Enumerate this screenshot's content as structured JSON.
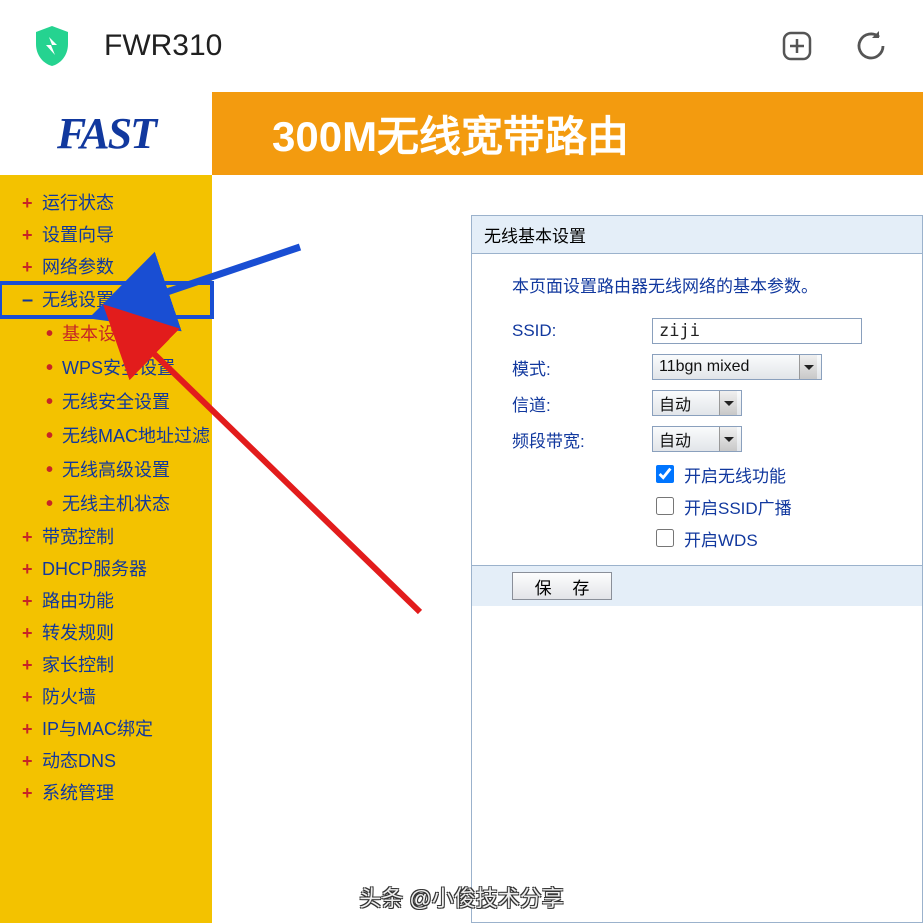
{
  "browser": {
    "title": "FWR310"
  },
  "banner": {
    "logo": "FAST",
    "title": "300M无线宽带路由"
  },
  "sidebar": {
    "items": [
      {
        "label": "运行状态",
        "type": "plus"
      },
      {
        "label": "设置向导",
        "type": "plus"
      },
      {
        "label": "网络参数",
        "type": "plus"
      },
      {
        "label": "无线设置",
        "type": "minus",
        "highlighted": true
      },
      {
        "label": "带宽控制",
        "type": "plus"
      },
      {
        "label": "DHCP服务器",
        "type": "plus"
      },
      {
        "label": "路由功能",
        "type": "plus"
      },
      {
        "label": "转发规则",
        "type": "plus"
      },
      {
        "label": "家长控制",
        "type": "plus"
      },
      {
        "label": "防火墙",
        "type": "plus"
      },
      {
        "label": "IP与MAC绑定",
        "type": "plus"
      },
      {
        "label": "动态DNS",
        "type": "plus"
      },
      {
        "label": "系统管理",
        "type": "plus"
      }
    ],
    "subitems": [
      {
        "label": "基本设置",
        "active": true
      },
      {
        "label": "WPS安全设置"
      },
      {
        "label": "无线安全设置"
      },
      {
        "label": "无线MAC地址过滤"
      },
      {
        "label": "无线高级设置"
      },
      {
        "label": "无线主机状态"
      }
    ]
  },
  "panel": {
    "header": "无线基本设置",
    "description": "本页面设置路由器无线网络的基本参数。",
    "rows": {
      "ssid_label": "SSID:",
      "ssid_value": "ziji",
      "mode_label": "模式:",
      "mode_value": "11bgn mixed",
      "channel_label": "信道:",
      "channel_value": "自动",
      "bandwidth_label": "频段带宽:",
      "bandwidth_value": "自动"
    },
    "checks": {
      "enable_wireless": "开启无线功能",
      "enable_ssid": "开启SSID广播",
      "enable_wds": "开启WDS"
    },
    "save": "保 存"
  },
  "caption": "头条 @小俊技术分享"
}
